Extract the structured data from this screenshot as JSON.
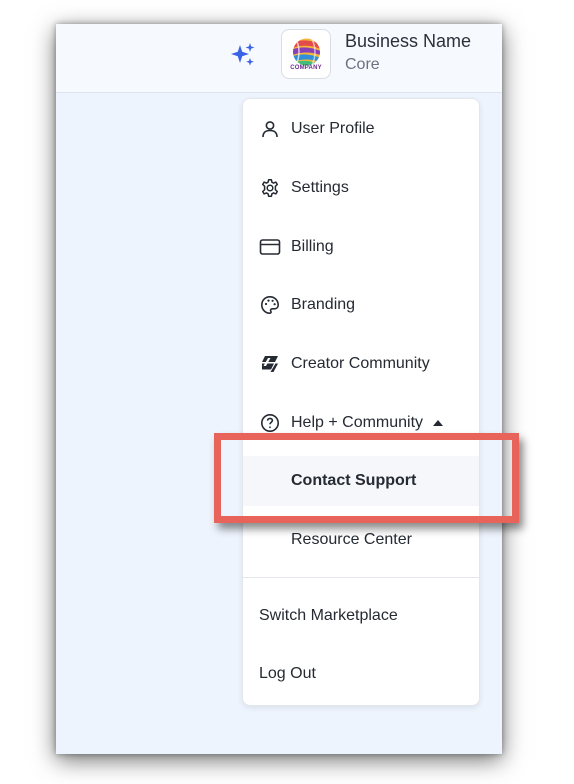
{
  "header": {
    "business_name": "Business Name",
    "plan": "Core",
    "logo_text": "COMPANY",
    "sparkle_icon": "sparkle-icon",
    "accent_color": "#3b63e6"
  },
  "menu": {
    "items": [
      {
        "label": "User Profile",
        "icon": "user-icon"
      },
      {
        "label": "Settings",
        "icon": "gear-icon"
      },
      {
        "label": "Billing",
        "icon": "credit-card-icon"
      },
      {
        "label": "Branding",
        "icon": "palette-icon"
      },
      {
        "label": "Creator Community",
        "icon": "community-logo-icon"
      },
      {
        "label": "Help + Community",
        "icon": "help-circle-icon",
        "expanded": true
      }
    ],
    "sub_items": [
      {
        "label": "Contact Support",
        "active": true
      },
      {
        "label": "Resource Center"
      }
    ],
    "footer_items": [
      {
        "label": "Switch Marketplace"
      },
      {
        "label": "Log Out"
      }
    ]
  },
  "annotation": {
    "highlight_color": "#e8635a"
  }
}
